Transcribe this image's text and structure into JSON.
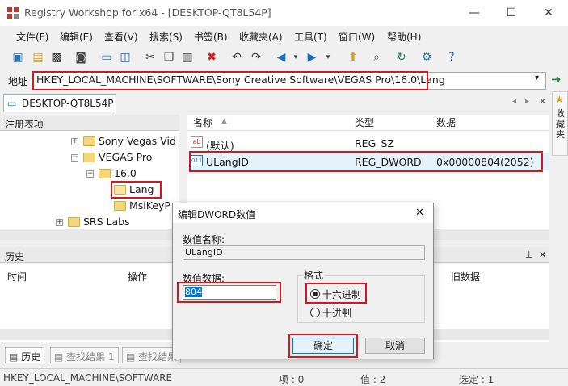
{
  "window": {
    "title": "Registry Workshop for x64 - [DESKTOP-QT8L54P]",
    "minimize": "—",
    "maximize": "☐",
    "close": "✕"
  },
  "menu": [
    "文件(F)",
    "编辑(E)",
    "查看(V)",
    "搜索(S)",
    "书签(B)",
    "收藏夹(A)",
    "工具(T)",
    "窗口(W)",
    "帮助(H)"
  ],
  "address": {
    "label": "地址",
    "value": "HKEY_LOCAL_MACHINE\\SOFTWARE\\Sony Creative Software\\VEGAS Pro\\16.0\\Lang"
  },
  "tab": {
    "label": "DESKTOP-QT8L54P"
  },
  "side_panel": {
    "label": "收藏夹"
  },
  "tree": {
    "header": "注册表项",
    "items": [
      "Sony Vegas Vid",
      "VEGAS Pro",
      "16.0",
      "Lang",
      "MsiKeyP",
      "SRS Labs"
    ]
  },
  "list": {
    "columns": [
      "名称",
      "类型",
      "数据"
    ],
    "rows": [
      {
        "name": "(默认)",
        "type": "REG_SZ",
        "data": ""
      },
      {
        "name": "ULangID",
        "type": "REG_DWORD",
        "data": "0x00000804(2052)"
      }
    ]
  },
  "history": {
    "header": "历史",
    "columns": [
      "时间",
      "操作",
      "旧数据"
    ]
  },
  "bottom_tabs": [
    "历史",
    "查找结果 1",
    "查找结果"
  ],
  "status": {
    "path": "HKEY_LOCAL_MACHINE\\SOFTWARE",
    "items": "项 : 0",
    "values": "值 : 2",
    "selected": "选定 : 1"
  },
  "dialog": {
    "title": "编辑DWORD数值",
    "name_label": "数值名称:",
    "name_value": "ULangID",
    "data_label": "数值数据:",
    "data_value": "804",
    "format_label": "格式",
    "hex_label": "十六进制",
    "dec_label": "十进制",
    "ok": "确定",
    "cancel": "取消",
    "close": "✕"
  },
  "colors": {
    "highlight_red": "#d9141b",
    "accent_blue": "#0078d7"
  }
}
